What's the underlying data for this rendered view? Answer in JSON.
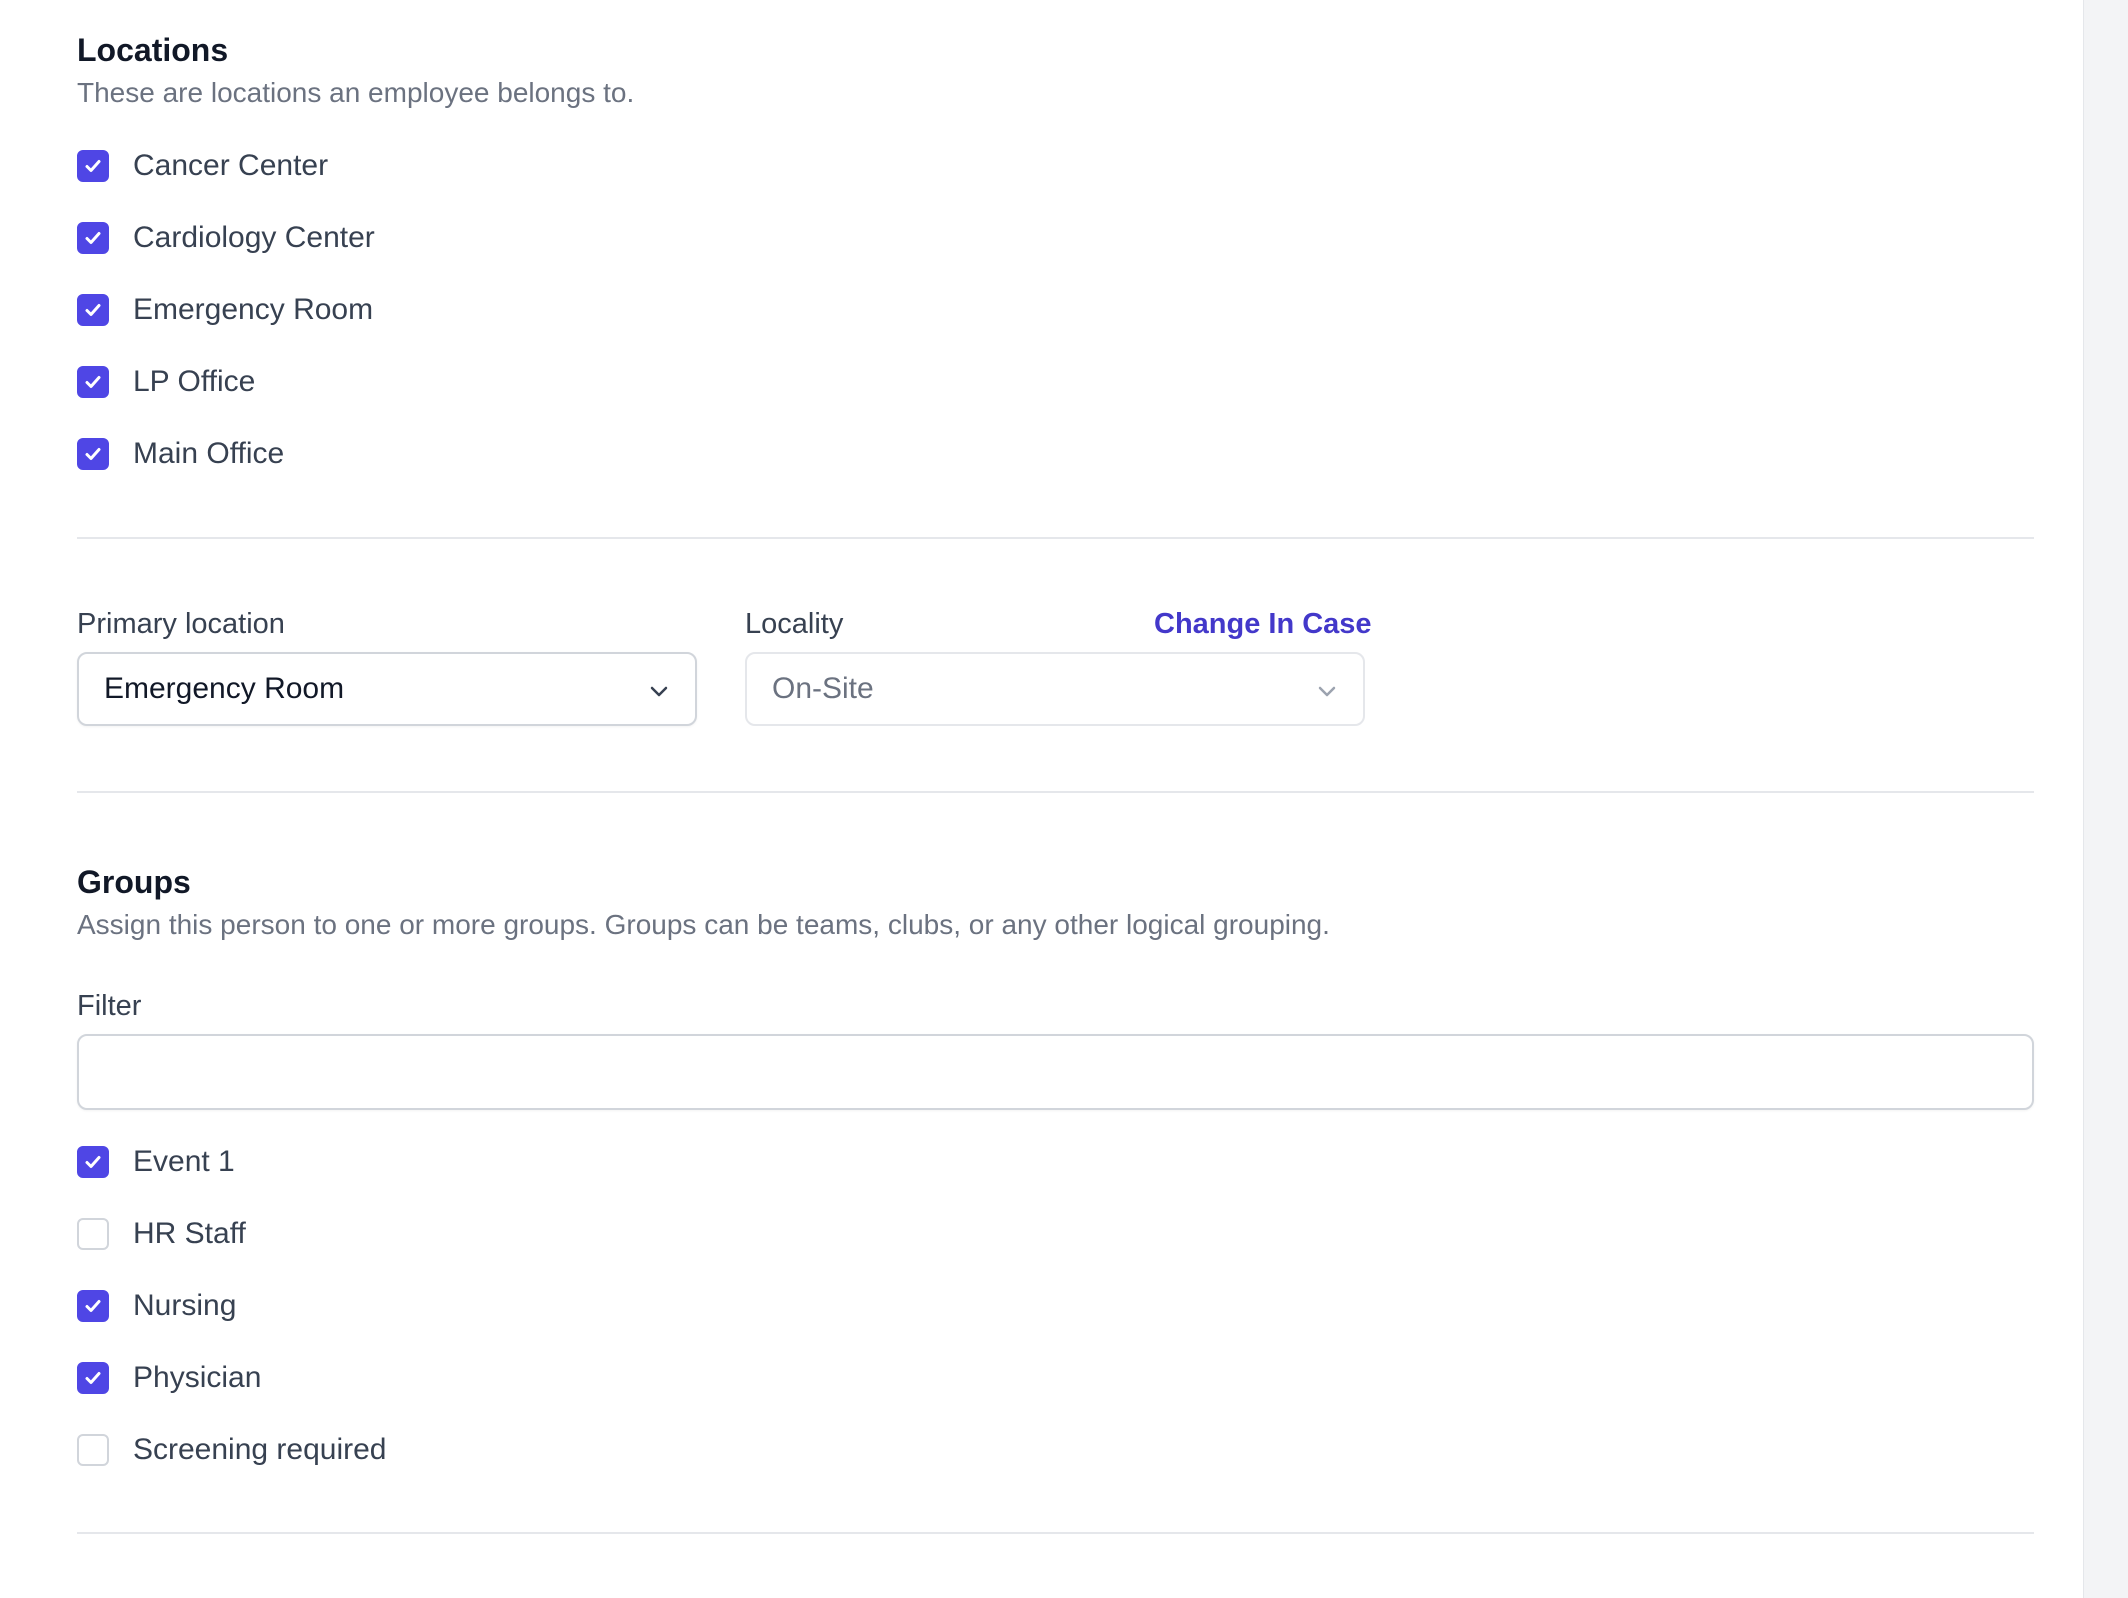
{
  "locations": {
    "title": "Locations",
    "description": "These are locations an employee belongs to.",
    "items": [
      {
        "label": "Cancer Center",
        "checked": true
      },
      {
        "label": "Cardiology Center",
        "checked": true
      },
      {
        "label": "Emergency Room",
        "checked": true
      },
      {
        "label": "LP Office",
        "checked": true
      },
      {
        "label": "Main Office",
        "checked": true
      }
    ]
  },
  "primary_location": {
    "label": "Primary location",
    "value": "Emergency Room"
  },
  "locality": {
    "label": "Locality",
    "value": "On-Site",
    "disabled": true,
    "change_link": "Change In Case"
  },
  "groups": {
    "title": "Groups",
    "description": "Assign this person to one or more groups. Groups can be teams, clubs, or any other logical grouping.",
    "filter_label": "Filter",
    "filter_value": "",
    "items": [
      {
        "label": "Event 1",
        "checked": true
      },
      {
        "label": "HR Staff",
        "checked": false
      },
      {
        "label": "Nursing",
        "checked": true
      },
      {
        "label": "Physician",
        "checked": true
      },
      {
        "label": "Screening required",
        "checked": false
      }
    ]
  },
  "colors": {
    "accent": "#4f46e5",
    "link": "#4338ca",
    "border": "#d1d5db",
    "divider": "#e5e7eb",
    "muted_text": "#6b7280"
  },
  "icons": {
    "checkbox_checked": "check-icon",
    "select_chevron": "chevron-down-icon"
  }
}
